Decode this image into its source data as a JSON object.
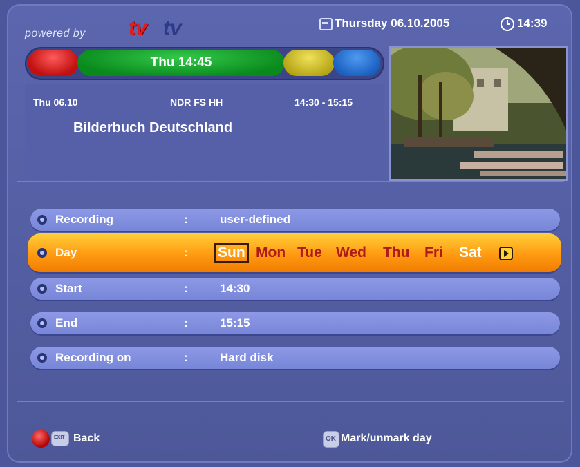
{
  "header": {
    "logo_prefix": "powered by",
    "logo_brand_a": "tv",
    "logo_brand_b": "tv",
    "date": "Thursday 06.10.2005",
    "time": "14:39"
  },
  "color_bar": {
    "green_label": "Thu 14:45"
  },
  "program": {
    "date": "Thu 06.10",
    "channel": "NDR FS HH",
    "time_range": "14:30 - 15:15",
    "title": "Bilderbuch Deutschland"
  },
  "settings": {
    "rows": [
      {
        "label": "Recording",
        "sep": ":",
        "value": "user-defined"
      },
      {
        "label": "Day",
        "sep": ":"
      },
      {
        "label": "Start",
        "sep": ":",
        "value": "14:30"
      },
      {
        "label": "End",
        "sep": ":",
        "value": "15:15"
      },
      {
        "label": "Recording on",
        "sep": ":",
        "value": "Hard disk"
      }
    ],
    "days": [
      "Sun",
      "Mon",
      "Tue",
      "Wed",
      "Thu",
      "Fri",
      "Sat"
    ]
  },
  "footer": {
    "back_label": "Back",
    "mark_label": "Mark/unmark day"
  },
  "colors": {
    "background": "#4b569b",
    "row": "#8592e2",
    "highlight": "#ff9a12",
    "day_unselected": "#b01a1a",
    "red_key": "#c01010",
    "green_key": "#0a8a1d",
    "yellow_key": "#b5a415",
    "blue_key": "#1a5fc0"
  },
  "icons": [
    "calendar-icon",
    "clock-icon",
    "bullet-icon",
    "next-icon",
    "red-key-icon",
    "exit-key-icon",
    "ok-key-icon"
  ]
}
